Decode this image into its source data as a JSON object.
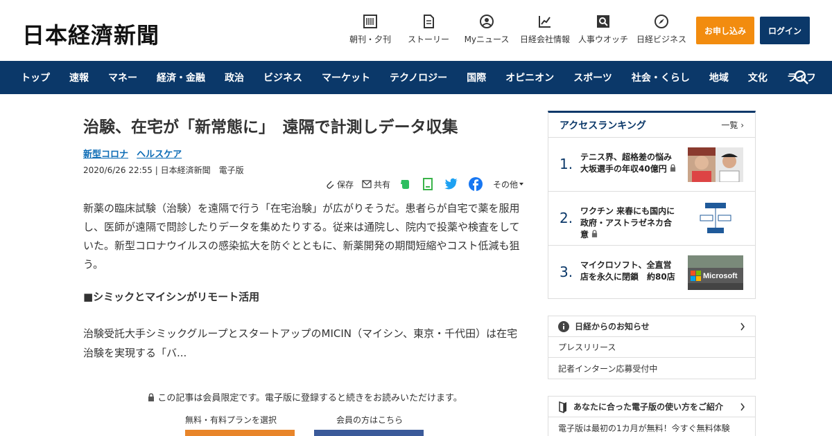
{
  "header": {
    "logo": "日本経濟新聞",
    "tools": [
      {
        "label": "朝刊・夕刊",
        "icon": "newspaper-icon"
      },
      {
        "label": "ストーリー",
        "icon": "document-icon"
      },
      {
        "label": "Myニュース",
        "icon": "user-icon"
      },
      {
        "label": "日経会社情報",
        "icon": "chart-icon"
      },
      {
        "label": "人事ウオッチ",
        "icon": "search-person-icon"
      },
      {
        "label": "日経ビジネス",
        "icon": "compass-icon"
      }
    ],
    "apply_label": "お申し込み",
    "login_label": "ログイン",
    "colors": {
      "apply": "#f28c0f",
      "navy": "#0b3869"
    }
  },
  "nav": {
    "items": [
      "トップ",
      "速報",
      "マネー",
      "経済・金融",
      "政治",
      "ビジネス",
      "マーケット",
      "テクノロジー",
      "国際",
      "オピニオン",
      "スポーツ",
      "社会・くらし",
      "地域",
      "文化",
      "ライフ"
    ]
  },
  "article": {
    "title": "治験、在宅が「新常態に」　遠隔で計測しデータ収集",
    "tags": [
      "新型コロナ",
      "ヘルスケア"
    ],
    "meta": "2020/6/26 22:55 | 日本経済新聞　電子版",
    "share": {
      "save": "保存",
      "share": "共有",
      "other": "その他"
    },
    "paragraph1": "新薬の臨床試験（治験）を遠隔で行う「在宅治験」が広がりそうだ。患者らが自宅で薬を服用し、医師が遠隔で問診したりデータを集めたりする。従来は通院し、院内で投薬や検査をしていた。新型コロナウイルスの感染拡大を防ぐとともに、新薬開発の期間短縮やコスト低減も狙う。",
    "subhead": "■シミックとマイシンがリモート活用",
    "paragraph2": "治験受託大手シミックグループとスタートアップのMICIN（マイシン、東京・千代田）は在宅治験を実現する「バ...",
    "paywall_note": "この記事は会員限定です。電子版に登録すると続きをお読みいただけます。",
    "plan_label": "無料・有料プランを選択",
    "member_label": "会員の方はこちら"
  },
  "ranking": {
    "title": "アクセスランキング",
    "more": "一覧",
    "items": [
      {
        "num": "1.",
        "text": "テニス界、超格差の悩み 大坂選手の年収40億円"
      },
      {
        "num": "2.",
        "text": "ワクチン 来春にも国内に 政府・アストラゼネカ合意"
      },
      {
        "num": "3.",
        "text": "マイクロソフト、全直営店を永久に閉鎖　約80店"
      }
    ]
  },
  "notice": {
    "title": "日経からのお知らせ",
    "rows": [
      "プレスリリース",
      "記者インターン応募受付中"
    ]
  },
  "guide": {
    "title": "あなたに合った電子版の使い方をご紹介",
    "row": "電子版は最初の1カ月が無料！今すぐ無料体験"
  }
}
